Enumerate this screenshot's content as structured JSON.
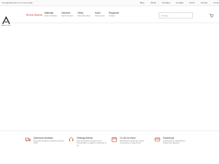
{
  "topbar": {
    "email": "biuro@drewnohurt.com.pl (email)",
    "links": [
      "Blog",
      "Oferta",
      "Doradca",
      "Kontakt",
      "Konto",
      "Koszyk",
      "Konto"
    ]
  },
  "logo": {
    "subtitle": "drewno hurt"
  },
  "nav": {
    "home": "Strona Główna",
    "items": [
      {
        "label": "Materiały",
        "sub": "Wybór Produktu"
      },
      {
        "label": "Kamienie",
        "sub": "Wybór Kamieni"
      },
      {
        "label": "Oferty",
        "sub": "Wszystkie Oferty"
      },
      {
        "label": "Konto",
        "sub": "Twoje Konto"
      },
      {
        "label": "Regulamin",
        "sub": "Kontakt"
      }
    ],
    "search_placeholder": "Szukaj..."
  },
  "features": [
    {
      "icon": "truck-icon",
      "title": "Darmowa dostawa",
      "desc": "Darmowa dostawa zamówień powyżej 300zł"
    },
    {
      "icon": "headset-icon",
      "title": "Obsługa klienta",
      "desc": "Nasi konsultanci dostępni są od Poniedziałku do piątku w godzinach 8-16"
    },
    {
      "icon": "calendar-icon",
      "title": "14 dni na zwrot",
      "desc": "Możliwość bezpłatnego zwrotu zamówienia w ciągu 14 dni"
    },
    {
      "icon": "card-icon",
      "title": "Gwarancja",
      "desc": "Gwarantujemy zadowolenie i bezpieczne płatności"
    }
  ]
}
